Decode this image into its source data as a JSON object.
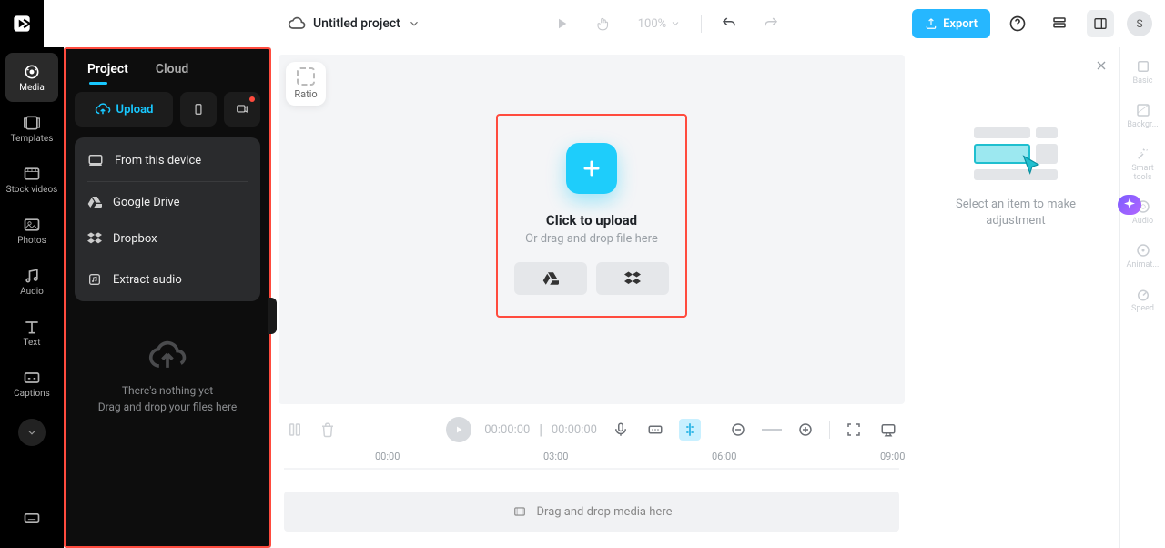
{
  "topbar": {
    "project_name": "Untitled project",
    "zoom": "100%",
    "export_label": "Export",
    "avatar_letter": "S"
  },
  "leftRail": {
    "items": [
      {
        "label": "Media"
      },
      {
        "label": "Templates"
      },
      {
        "label": "Stock videos"
      },
      {
        "label": "Photos"
      },
      {
        "label": "Audio"
      },
      {
        "label": "Text"
      },
      {
        "label": "Captions"
      }
    ]
  },
  "leftPanel": {
    "tabs": {
      "project": "Project",
      "cloud": "Cloud"
    },
    "upload_label": "Upload",
    "menu": {
      "from_device": "From this device",
      "google_drive": "Google Drive",
      "dropbox": "Dropbox",
      "extract_audio": "Extract audio"
    },
    "empty_line1": "There's nothing yet",
    "empty_line2": "Drag and drop your files here"
  },
  "canvas": {
    "ratio_label": "Ratio",
    "upload_title": "Click to upload",
    "upload_sub": "Or drag and drop file here"
  },
  "timeline": {
    "time_current": "00:00:00",
    "time_total": "00:00:00",
    "ticks": [
      "00:00",
      "03:00",
      "06:00",
      "09:00"
    ],
    "drop_label": "Drag and drop media here"
  },
  "rightPanel": {
    "hint_line1": "Select an item to make",
    "hint_line2": "adjustment"
  },
  "rightRail": {
    "items": [
      "Basic",
      "Backgr...",
      "Smart tools",
      "Audio",
      "Animat...",
      "Speed"
    ]
  }
}
